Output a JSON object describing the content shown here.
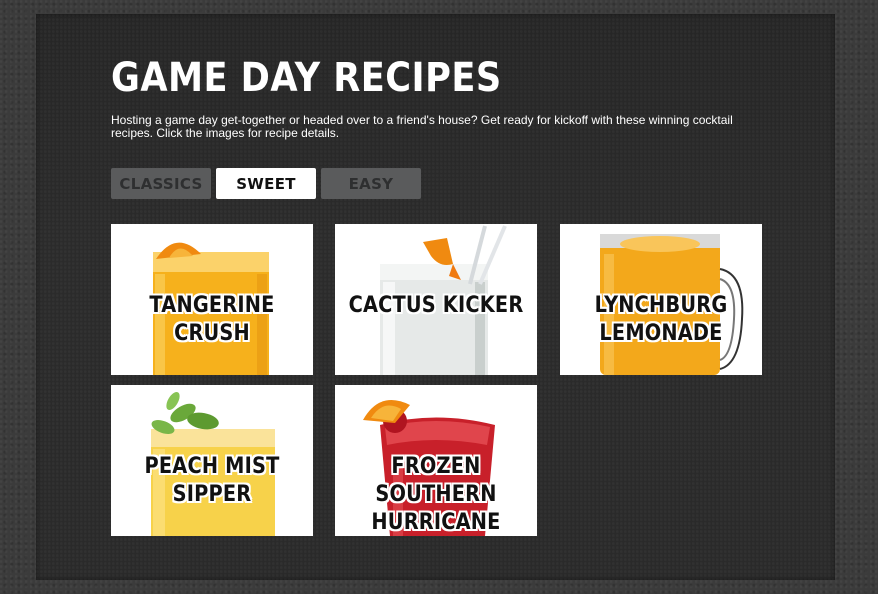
{
  "page": {
    "title": "GAME DAY RECIPES",
    "intro": "Hosting a game day get-together or headed over to a friend's house? Get ready for kickoff with these winning cocktail recipes. Click the images for recipe details."
  },
  "tabs": [
    {
      "label": "CLASSICS",
      "active": false
    },
    {
      "label": "SWEET",
      "active": true
    },
    {
      "label": "EASY",
      "active": false
    }
  ],
  "recipes": [
    {
      "label": "TANGERINE\nCRUSH",
      "drink_color": "#f6b11c"
    },
    {
      "label": "CACTUS KICKER",
      "drink_color": "#e9ecec"
    },
    {
      "label": "LYNCHBURG\nLEMONADE",
      "drink_color": "#f3a81b"
    },
    {
      "label": "PEACH MIST\nSIPPER",
      "drink_color": "#f7d24a"
    },
    {
      "label": "FROZEN SOUTHERN\nHURRICANE",
      "drink_color": "#c8202a"
    }
  ]
}
